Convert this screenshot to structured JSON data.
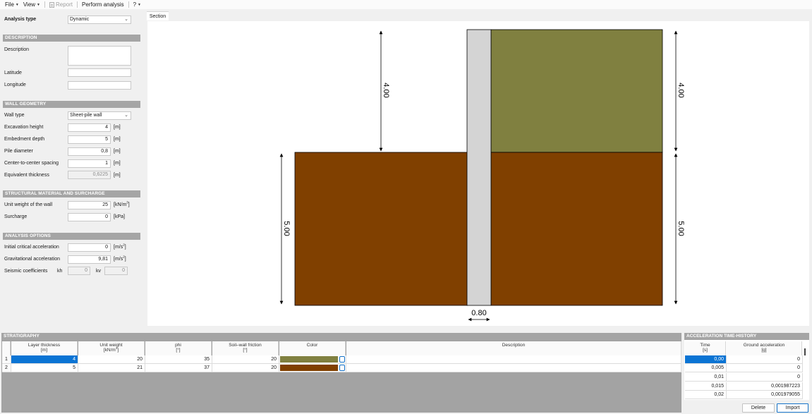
{
  "menu": {
    "file": "File",
    "view": "View",
    "report": "Report",
    "perform": "Perform analysis",
    "help": "?"
  },
  "analysis_type": {
    "label": "Analysis type",
    "value": "Dynamic"
  },
  "description_section": {
    "header": "DESCRIPTION",
    "description_label": "Description",
    "latitude_label": "Latitude",
    "longitude_label": "Longitude"
  },
  "wall_geometry": {
    "header": "WALL GEOMETRY",
    "wall_type_label": "Wall type",
    "wall_type_value": "Sheet-pile wall",
    "excavation_height": {
      "label": "Excavation height",
      "value": "4",
      "unit": "[m]"
    },
    "embedment_depth": {
      "label": "Embedment depth",
      "value": "5",
      "unit": "[m]"
    },
    "pile_diameter": {
      "label": "Pile diameter",
      "value": "0,8",
      "unit": "[m]"
    },
    "spacing": {
      "label": "Center-to-center spacing",
      "value": "1",
      "unit": "[m]"
    },
    "equivalent_thickness": {
      "label": "Equivalent thickness",
      "value": "0,6225",
      "unit": "[m]"
    }
  },
  "structural": {
    "header": "STRUCTURAL MATERIAL AND SURCHARGE",
    "unit_weight": {
      "label": "Unit weight of the wall",
      "value": "25",
      "unit_prefix": "[kN/m",
      "unit_sup": "3",
      "unit_suffix": "]"
    },
    "surcharge": {
      "label": "Surcharge",
      "value": "0",
      "unit": "[kPa]"
    }
  },
  "analysis_options": {
    "header": "ANALYSIS OPTIONS",
    "initial_critical": {
      "label": "Initial critical acceleration",
      "value": "0",
      "unit_prefix": "[m/s",
      "unit_sup": "2",
      "unit_suffix": "]"
    },
    "gravitational": {
      "label": "Gravitational acceleration",
      "value": "9,81",
      "unit_prefix": "[m/s",
      "unit_sup": "2",
      "unit_suffix": "]"
    },
    "seismic": {
      "label": "Seismic coefficients",
      "kh_label": "kh",
      "kh_value": "0",
      "kv_label": "kv",
      "kv_value": "0"
    }
  },
  "section_tab": {
    "label": "Section"
  },
  "section_drawing": {
    "dim_left_top": "4.00",
    "dim_left_bottom": "5.00",
    "dim_right_top": "4.00",
    "dim_right_bottom": "5.00",
    "dim_wall": "0.80",
    "colors": {
      "soil1": "#808040",
      "soil2": "#804000",
      "wall": "#d4d4d4"
    }
  },
  "stratigraphy": {
    "header": "STRATIGRAPHY",
    "columns": [
      {
        "line1": "Layer thickness",
        "line2": "[m]"
      },
      {
        "line1": "Unit weight",
        "line2_prefix": "[kN/m",
        "line2_sup": "3",
        "line2_suffix": "]"
      },
      {
        "line1": "phi",
        "line2": "[°]"
      },
      {
        "line1": "Soil–wall friction",
        "line2": "[°]"
      },
      {
        "line1": "Color",
        "line2": ""
      },
      {
        "line1": "Description",
        "line2": ""
      }
    ],
    "rows": [
      {
        "index": "1",
        "thickness": "4",
        "unit_weight": "20",
        "phi": "35",
        "friction": "20",
        "color": "#808040",
        "description": ""
      },
      {
        "index": "2",
        "thickness": "5",
        "unit_weight": "21",
        "phi": "37",
        "friction": "20",
        "color": "#804000",
        "description": ""
      }
    ]
  },
  "acceleration": {
    "header": "ACCELERATION TIME-HISTORY",
    "col_time": {
      "line1": "Time",
      "line2": "[s]"
    },
    "col_accel": {
      "line1": "Ground acceleration",
      "line2": "[g]"
    },
    "rows": [
      {
        "time": "0,00",
        "accel": "0"
      },
      {
        "time": "0,005",
        "accel": "0"
      },
      {
        "time": "0,01",
        "accel": "0"
      },
      {
        "time": "0,015",
        "accel": "0,001987223"
      },
      {
        "time": "0,02",
        "accel": "0,001979055"
      }
    ],
    "delete_label": "Delete",
    "import_label": "Import"
  }
}
